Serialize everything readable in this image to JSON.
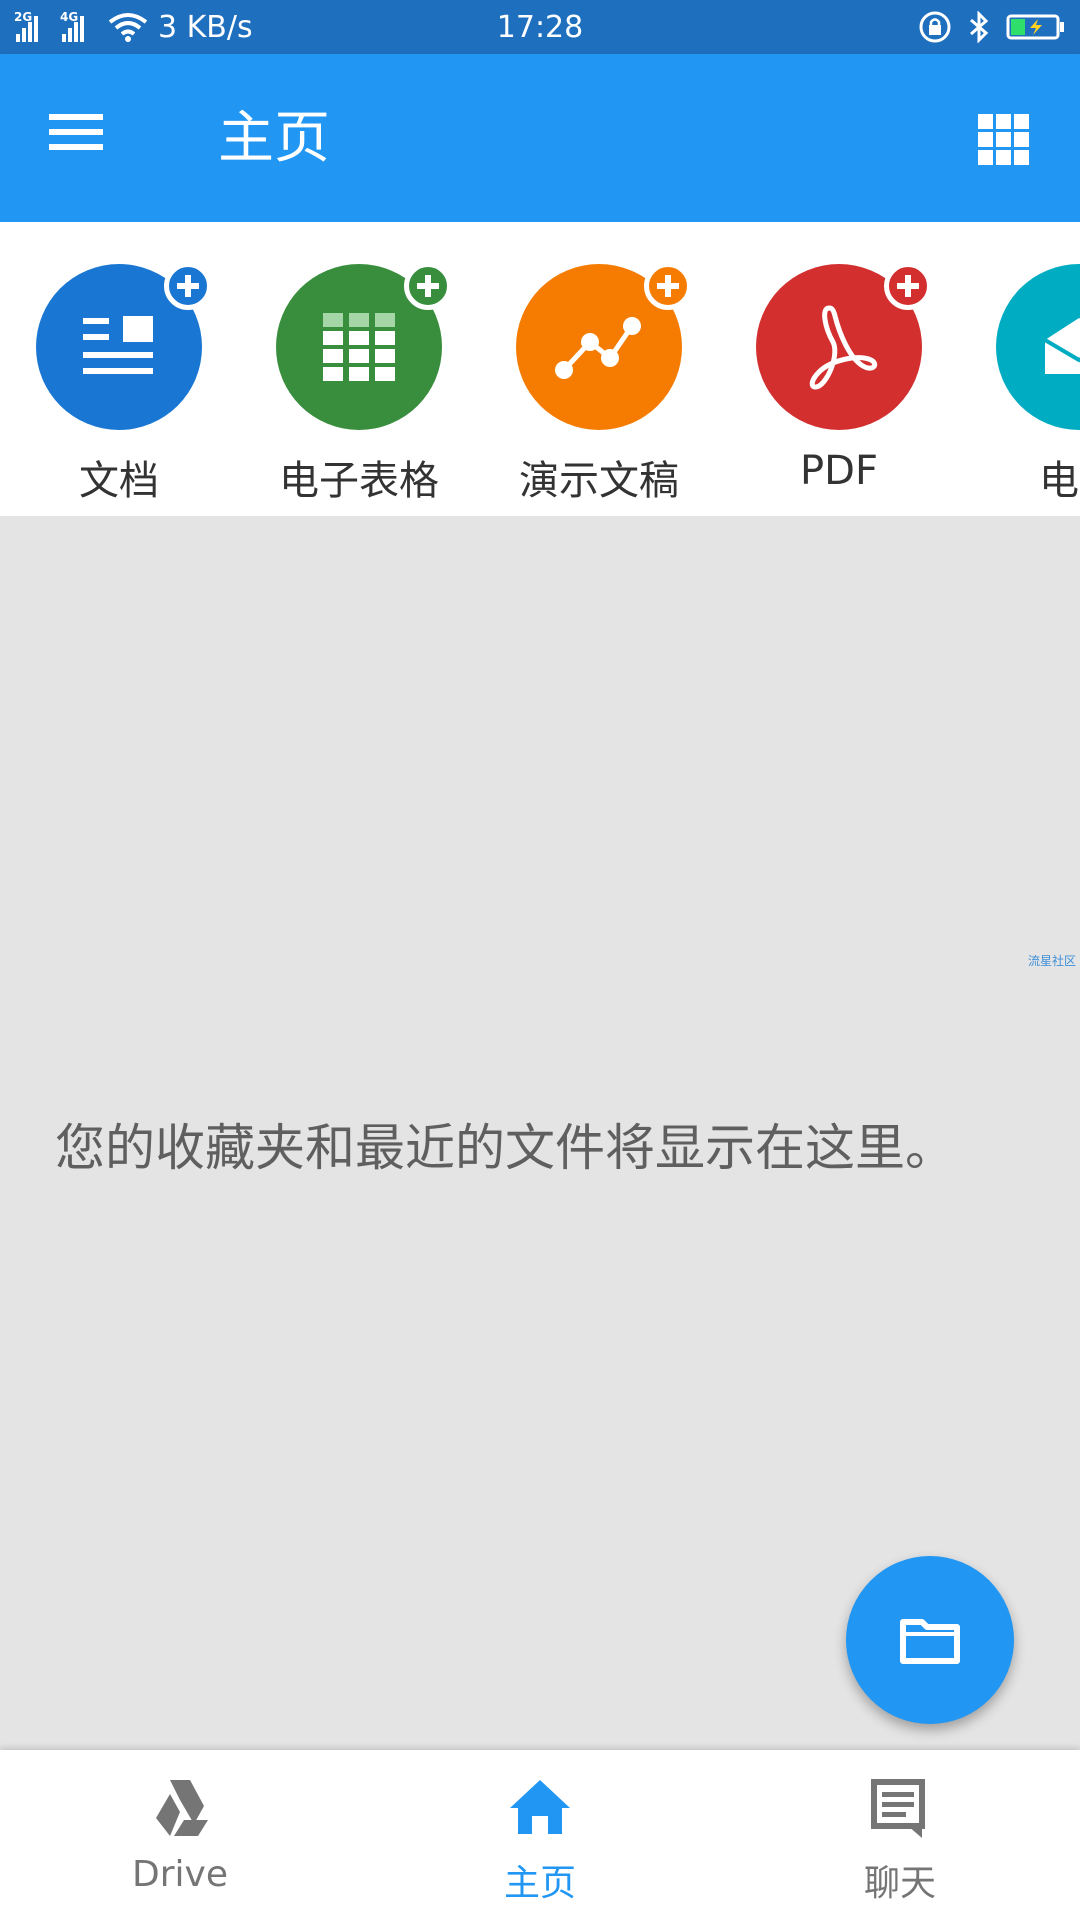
{
  "status_bar": {
    "signal_1": "2G",
    "signal_2": "4G",
    "speed": "3 KB/s",
    "time": "17:28"
  },
  "app_bar": {
    "title": "主页",
    "menu_icon": "hamburger-menu-icon",
    "view_icon": "grid-view-icon"
  },
  "shortcuts": [
    {
      "label": "文档",
      "icon": "document-icon",
      "color": "#1976d2"
    },
    {
      "label": "电子表格",
      "icon": "spreadsheet-icon",
      "color": "#388e3c"
    },
    {
      "label": "演示文稿",
      "icon": "presentation-icon",
      "color": "#f57c00"
    },
    {
      "label": "PDF",
      "icon": "pdf-icon",
      "color": "#d32f2f"
    },
    {
      "label": "电子",
      "icon": "email-icon",
      "color": "#00acc1"
    }
  ],
  "empty_state": {
    "message": "您的收藏夹和最近的文件将显示在这里。"
  },
  "watermark": "流星社区",
  "fab": {
    "icon": "folder-icon"
  },
  "bottom_nav": {
    "items": [
      {
        "label": "Drive",
        "icon": "drive-icon"
      },
      {
        "label": "主页",
        "icon": "home-icon"
      },
      {
        "label": "聊天",
        "icon": "chat-icon"
      }
    ],
    "active": "主页"
  },
  "colors": {
    "primary": "#2196f3",
    "status_bar": "#1f6fbf",
    "background": "#e4e4e4"
  }
}
